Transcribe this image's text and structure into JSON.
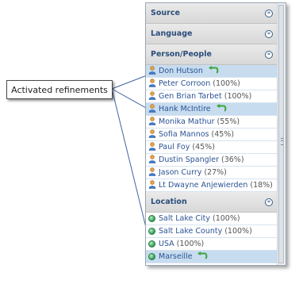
{
  "callout": {
    "label": "Activated refinements"
  },
  "sections": [
    {
      "title": "Source",
      "state": "collapsed"
    },
    {
      "title": "Language",
      "state": "collapsed"
    },
    {
      "title": "Person/People",
      "state": "expanded"
    },
    {
      "title": "Location",
      "state": "expanded"
    }
  ],
  "toggle_glyphs": {
    "collapsed": "»",
    "expanded": "«"
  },
  "people": [
    {
      "name": "Don Hutson",
      "count": "",
      "active": true
    },
    {
      "name": "Peter Corroon",
      "count": "(100%)",
      "active": false
    },
    {
      "name": "Gen Brian Tarbet",
      "count": "(100%)",
      "active": false
    },
    {
      "name": "Hank McIntire",
      "count": "",
      "active": true
    },
    {
      "name": "Monika Mathur",
      "count": "(55%)",
      "active": false
    },
    {
      "name": "Sofia Mannos",
      "count": "(45%)",
      "active": false
    },
    {
      "name": "Paul Foy",
      "count": "(45%)",
      "active": false
    },
    {
      "name": "Dustin Spangler",
      "count": "(36%)",
      "active": false
    },
    {
      "name": "Jason Curry",
      "count": "(27%)",
      "active": false
    },
    {
      "name": "Lt Dwayne Anjewierden",
      "count": "(18%)",
      "active": false
    }
  ],
  "locations": [
    {
      "name": "Salt Lake City",
      "count": "(100%)",
      "active": false
    },
    {
      "name": "Salt Lake County",
      "count": "(100%)",
      "active": false
    },
    {
      "name": "USA",
      "count": "(100%)",
      "active": false
    },
    {
      "name": "Marseille",
      "count": "",
      "active": true
    }
  ],
  "colors": {
    "link": "#2b5394",
    "header_text": "#2a4d7a",
    "active_row": "#c7dcef",
    "undo": "#3aa53a"
  },
  "icons": {
    "person": "person-icon",
    "location": "globe-icon",
    "remove": "undo-arrow-icon",
    "toggle": "circle-chevron-icon"
  }
}
